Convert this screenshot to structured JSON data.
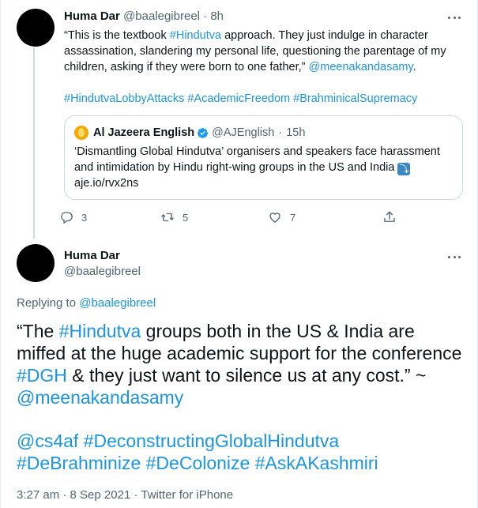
{
  "tweet1": {
    "name": "Huma Dar",
    "handle": "@baalegibreel",
    "sep": "·",
    "time": "8h",
    "text_a": "“This is the textbook ",
    "tag_a": "#Hindutva",
    "text_b": " approach. They just indulge in character assassination, slandering my personal life, questioning the parentage of my children, asking if they were born to one father,” ",
    "mention": "@meenakandasamy",
    "text_c": ".",
    "hashtags": [
      "#HindutvaLobbyAttacks",
      "#AcademicFreedom",
      "#BrahminicalSupremacy"
    ],
    "quote": {
      "name": "Al Jazeera English",
      "handle": "@AJEnglish",
      "sep": "·",
      "time": "15h",
      "text": "‘Dismantling Global Hindutva’ organisers and speakers face harassment and intimidation by Hindu right-wing groups in the US and India ",
      "emoji": "⤵",
      "link": "aje.io/rvx2ns"
    },
    "actions": {
      "replies": "3",
      "retweets": "5",
      "likes": "7"
    }
  },
  "tweet2": {
    "name": "Huma Dar",
    "handle": "@baalegibreel",
    "replying_label": "Replying to ",
    "replying_to": "@baalegibreel",
    "text_a": "“The ",
    "tag_a": "#Hindutva",
    "text_b": " groups both in the US & India are miffed at the huge academic support for the conference ",
    "tag_b": "#DGH",
    "text_c": " & they just want to silence us at any cost.” ~ ",
    "mention": "@meenakandasamy",
    "tags_line1": [
      "@cs4af",
      "#DeconstructingGlobalHindutva"
    ],
    "tags_line2": [
      "#DeBrahminize",
      "#DeColonize",
      "#AskAKashmiri"
    ],
    "time": "3:27 am",
    "sep": "·",
    "date": "8 Sep 2021",
    "sep2": "·",
    "source": "Twitter for iPhone"
  },
  "colors": {
    "link": "#1b95e0",
    "muted": "#536471",
    "text": "#0f1419",
    "border": "#cfd9de",
    "verified": "#1d9bf0"
  }
}
